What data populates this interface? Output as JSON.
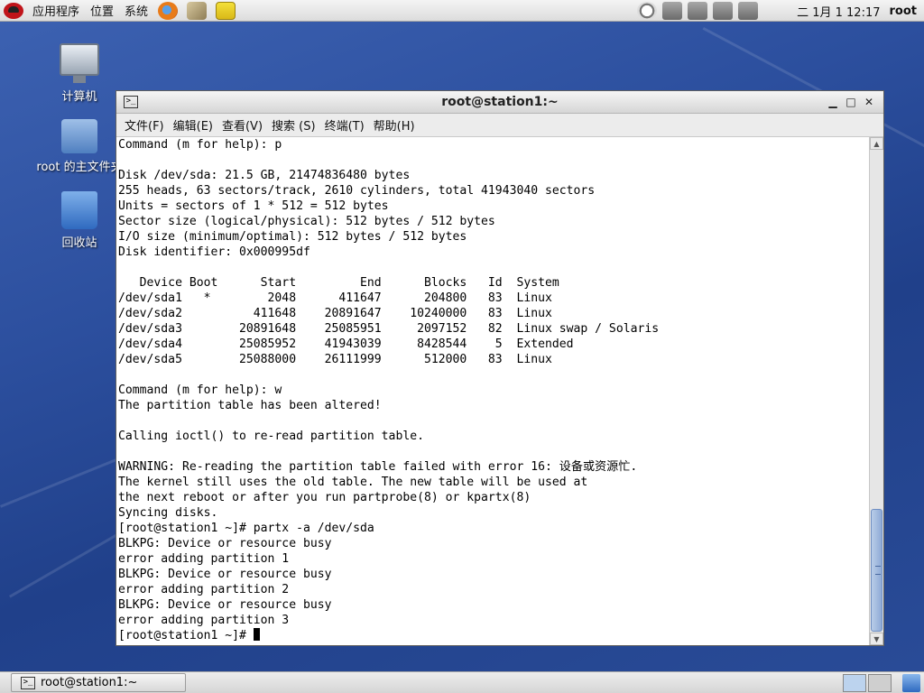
{
  "top_panel": {
    "menus": [
      "应用程序",
      "位置",
      "系统"
    ],
    "clock": "二  1月  1 12:17",
    "user": "root"
  },
  "desktop": {
    "icons": [
      {
        "label": "计算机",
        "icon": "computer-icon"
      },
      {
        "label": "root 的主文件夹",
        "icon": "home-folder-icon"
      },
      {
        "label": "回收站",
        "icon": "trash-icon"
      }
    ]
  },
  "terminal": {
    "title": "root@station1:~",
    "menu": [
      "文件(F)",
      "编辑(E)",
      "查看(V)",
      "搜索 (S)",
      "终端(T)",
      "帮助(H)"
    ],
    "lines": [
      "Command (m for help): p",
      "",
      "Disk /dev/sda: 21.5 GB, 21474836480 bytes",
      "255 heads, 63 sectors/track, 2610 cylinders, total 41943040 sectors",
      "Units = sectors of 1 * 512 = 512 bytes",
      "Sector size (logical/physical): 512 bytes / 512 bytes",
      "I/O size (minimum/optimal): 512 bytes / 512 bytes",
      "Disk identifier: 0x000995df",
      "",
      "   Device Boot      Start         End      Blocks   Id  System",
      "/dev/sda1   *        2048      411647      204800   83  Linux",
      "/dev/sda2          411648    20891647    10240000   83  Linux",
      "/dev/sda3        20891648    25085951     2097152   82  Linux swap / Solaris",
      "/dev/sda4        25085952    41943039     8428544    5  Extended",
      "/dev/sda5        25088000    26111999      512000   83  Linux",
      "",
      "Command (m for help): w",
      "The partition table has been altered!",
      "",
      "Calling ioctl() to re-read partition table.",
      "",
      "WARNING: Re-reading the partition table failed with error 16: 设备或资源忙.",
      "The kernel still uses the old table. The new table will be used at",
      "the next reboot or after you run partprobe(8) or kpartx(8)",
      "Syncing disks.",
      "[root@station1 ~]# partx -a /dev/sda",
      "BLKPG: Device or resource busy",
      "error adding partition 1",
      "BLKPG: Device or resource busy",
      "error adding partition 2",
      "BLKPG: Device or resource busy",
      "error adding partition 3"
    ],
    "prompt": "[root@station1 ~]# "
  },
  "taskbar": {
    "window_button": "root@station1:~"
  }
}
